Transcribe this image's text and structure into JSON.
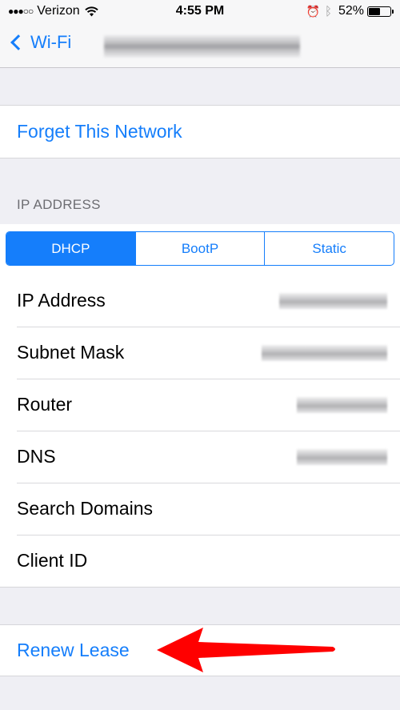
{
  "status_bar": {
    "signal": "●●●○○",
    "carrier": "Verizon",
    "time": "4:55 PM",
    "battery_percent_label": "52%",
    "battery_level": 0.52,
    "icons": [
      "signal-dots",
      "wifi-icon",
      "alarm-icon",
      "bluetooth-icon",
      "battery-icon"
    ]
  },
  "nav": {
    "back_label": "Wi-Fi",
    "title": "[blurred network name]"
  },
  "forget": {
    "label": "Forget This Network"
  },
  "ip_section": {
    "header": "IP ADDRESS",
    "segments": [
      {
        "label": "DHCP",
        "selected": true
      },
      {
        "label": "BootP",
        "selected": false
      },
      {
        "label": "Static",
        "selected": false
      }
    ],
    "rows": [
      {
        "label": "IP Address",
        "value": "[blurred]"
      },
      {
        "label": "Subnet Mask",
        "value": "[blurred]"
      },
      {
        "label": "Router",
        "value": "[blurred]"
      },
      {
        "label": "DNS",
        "value": "[blurred]"
      },
      {
        "label": "Search Domains",
        "value": ""
      },
      {
        "label": "Client ID",
        "value": ""
      }
    ]
  },
  "renew": {
    "label": "Renew Lease"
  },
  "annotation": {
    "type": "red-arrow",
    "points_to": "Renew Lease",
    "color": "#ff0000"
  },
  "colors": {
    "accent": "#157efb",
    "background": "#efeff4",
    "section_header": "#6d6d72"
  }
}
